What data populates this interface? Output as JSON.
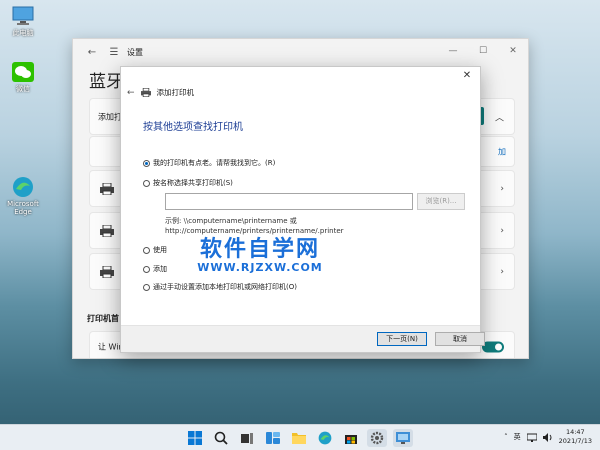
{
  "desktop": {
    "icons": [
      {
        "label": "此电脑",
        "icon": "computer-icon"
      },
      {
        "label": "微信",
        "icon": "wechat-icon"
      },
      {
        "label": "Microsoft Edge",
        "icon": "edge-icon"
      }
    ]
  },
  "settings": {
    "title": "设置",
    "heading": "蓝牙",
    "add_row_label": "添加打",
    "add_link": "加",
    "section_label": "打印机首",
    "toggle_row_label": "让 Win"
  },
  "dialog": {
    "header": "添加打印机",
    "title": "按其他选项查找打印机",
    "options": [
      {
        "label": "我的打印机有点老。请帮我找到它。(R)",
        "selected": true
      },
      {
        "label": "按名称选择共享打印机(S)",
        "selected": false
      },
      {
        "label": "使用",
        "selected": false
      },
      {
        "label": "添加",
        "selected": false
      },
      {
        "label": "通过手动设置添加本地打印机或网络打印机(O)",
        "selected": false
      }
    ],
    "share_input_value": "",
    "browse_label": "浏览(R)...",
    "example_line1": "示例: \\\\computername\\printername 或",
    "example_line2": "http://computername/printers/printername/.printer",
    "next_label": "下一页(N)",
    "cancel_label": "取消"
  },
  "watermark": {
    "text": "软件自学网",
    "url": "WWW.RJZXW.COM"
  },
  "taskbar": {
    "apps": [
      "windows-start-icon",
      "search-icon",
      "task-view-icon",
      "widgets-icon",
      "file-explorer-icon",
      "edge-icon",
      "store-icon",
      "settings-icon",
      "control-panel-icon"
    ],
    "lang": "英",
    "time": "14:47",
    "date": "2021/7/13"
  },
  "colors": {
    "accent": "#0f7c7c",
    "link": "#0f6cbd",
    "dialog_title": "#1e3f95"
  }
}
